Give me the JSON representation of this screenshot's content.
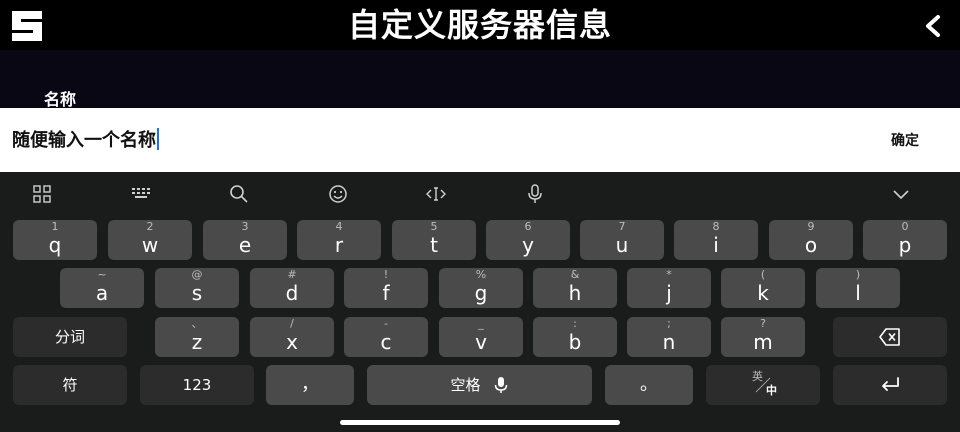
{
  "header": {
    "title": "自定义服务器信息"
  },
  "form": {
    "name_label": "名称",
    "input_value": "随便输入一个名称",
    "confirm_label": "确定"
  },
  "keyboard": {
    "row1": [
      {
        "hint": "1",
        "key": "q"
      },
      {
        "hint": "2",
        "key": "w"
      },
      {
        "hint": "3",
        "key": "e"
      },
      {
        "hint": "4",
        "key": "r"
      },
      {
        "hint": "5",
        "key": "t"
      },
      {
        "hint": "6",
        "key": "y"
      },
      {
        "hint": "7",
        "key": "u"
      },
      {
        "hint": "8",
        "key": "i"
      },
      {
        "hint": "9",
        "key": "o"
      },
      {
        "hint": "0",
        "key": "p"
      }
    ],
    "row2": [
      {
        "hint": "~",
        "key": "a"
      },
      {
        "hint": "@",
        "key": "s"
      },
      {
        "hint": "#",
        "key": "d"
      },
      {
        "hint": "!",
        "key": "f"
      },
      {
        "hint": "%",
        "key": "g"
      },
      {
        "hint": "&",
        "key": "h"
      },
      {
        "hint": "*",
        "key": "j"
      },
      {
        "hint": "(",
        "key": "k"
      },
      {
        "hint": ")",
        "key": "l"
      }
    ],
    "row3": [
      {
        "hint": "、",
        "key": "z"
      },
      {
        "hint": "/",
        "key": "x"
      },
      {
        "hint": "-",
        "key": "c"
      },
      {
        "hint": "_",
        "key": "v"
      },
      {
        "hint": ":",
        "key": "b"
      },
      {
        "hint": ";",
        "key": "n"
      },
      {
        "hint": "?",
        "key": "m"
      }
    ],
    "segment_label": "分词",
    "symbol_label": "符",
    "numbers_label": "123",
    "comma_label": "，",
    "space_label": "空格",
    "period_label": "。",
    "lang_top": "英",
    "lang_bottom": "中"
  }
}
